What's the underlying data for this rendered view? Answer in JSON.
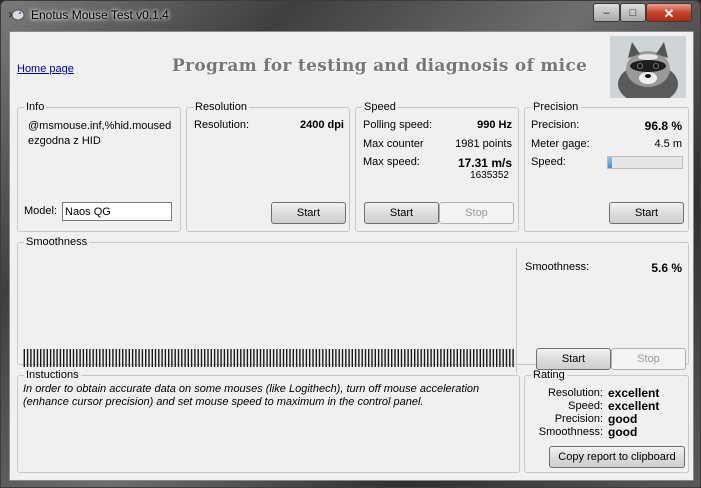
{
  "window": {
    "title": "Enotus Mouse Test v0.1.4",
    "controls": {
      "minimize": "–",
      "maximize": "□",
      "close": "✕"
    }
  },
  "header": {
    "home_link": "Home page",
    "heading": "Program for testing and diagnosis of mice",
    "photo_icon": "raccoon-photo"
  },
  "info": {
    "legend": "Info",
    "device_text": "@msmouse.inf,%hid.mousedezgodna z HID",
    "model_label": "Model:",
    "model_value": "Naos QG"
  },
  "resolution": {
    "legend": "Resolution",
    "label": "Resolution:",
    "value": "2400 dpi",
    "start_label": "Start"
  },
  "speed": {
    "legend": "Speed",
    "polling_label": "Polling speed:",
    "polling_value": "990 Hz",
    "counter_label": "Max counter",
    "counter_value": "1981 points",
    "max_speed_label": "Max  speed:",
    "max_speed_value": "17.31 m/s",
    "max_speed_sub": "1635352",
    "start_label": "Start",
    "stop_label": "Stop"
  },
  "precision": {
    "legend": "Precision",
    "precision_label": "Precision:",
    "precision_value": "96.8 %",
    "gage_label": "Meter gage:",
    "gage_value": "4.5 m",
    "speed_label": "Speed:",
    "speed_progress": 0.06,
    "start_label": "Start"
  },
  "smoothness": {
    "legend": "Smoothness",
    "label": "Smoothness:",
    "value": "5.6 %",
    "start_label": "Start",
    "stop_label": "Stop",
    "bar_count": 150
  },
  "instructions": {
    "legend": "Instuctions",
    "text": "In order to obtain accurate data on some mouses (like Logithech), turn off mouse acceleration (enhance cursor precision) and set mouse speed to maximum in the control panel."
  },
  "rating": {
    "legend": "Rating",
    "items": [
      {
        "label": "Resolution:",
        "value": "excellent"
      },
      {
        "label": "Speed:",
        "value": "excellent"
      },
      {
        "label": "Precision:",
        "value": "good"
      },
      {
        "label": "Smoothness:",
        "value": "good"
      }
    ],
    "copy_label": "Copy report to clipboard"
  },
  "colors": {
    "link": "#0000cc",
    "progress": "#3a8fd6",
    "close": "#c8442c"
  }
}
